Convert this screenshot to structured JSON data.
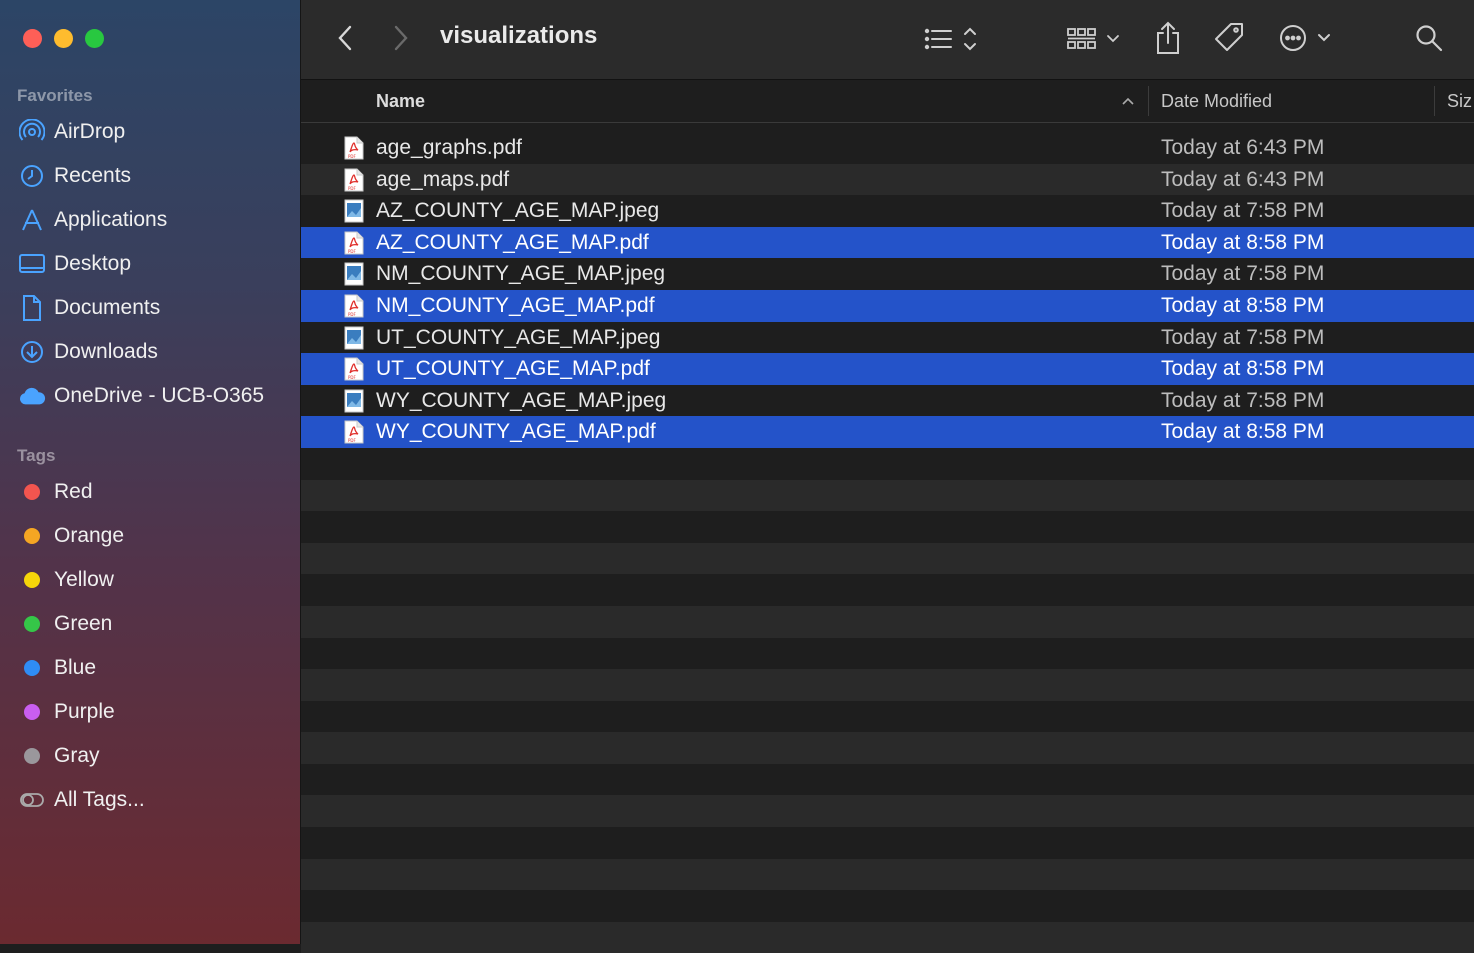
{
  "window": {
    "title": "visualizations"
  },
  "sidebar": {
    "favorites_label": "Favorites",
    "favorites": [
      {
        "label": "AirDrop",
        "icon": "airdrop-icon"
      },
      {
        "label": "Recents",
        "icon": "clock-icon"
      },
      {
        "label": "Applications",
        "icon": "applications-icon"
      },
      {
        "label": "Desktop",
        "icon": "desktop-icon"
      },
      {
        "label": "Documents",
        "icon": "document-icon"
      },
      {
        "label": "Downloads",
        "icon": "download-icon"
      },
      {
        "label": "OneDrive - UCB-O365",
        "icon": "cloud-icon"
      }
    ],
    "tags_label": "Tags",
    "tags": [
      {
        "label": "Red",
        "color": "#f2554f"
      },
      {
        "label": "Orange",
        "color": "#f5a623"
      },
      {
        "label": "Yellow",
        "color": "#f5d60a"
      },
      {
        "label": "Green",
        "color": "#35c648"
      },
      {
        "label": "Blue",
        "color": "#2f8cf5"
      },
      {
        "label": "Purple",
        "color": "#c95ef0"
      },
      {
        "label": "Gray",
        "color": "#9a979c"
      },
      {
        "label": "All Tags...",
        "color": ""
      }
    ]
  },
  "columns": {
    "name": "Name",
    "date": "Date Modified",
    "size": "Siz"
  },
  "files": [
    {
      "name": "age_graphs.pdf",
      "date": "Today at 6:43 PM",
      "type": "pdf",
      "selected": false
    },
    {
      "name": "age_maps.pdf",
      "date": "Today at 6:43 PM",
      "type": "pdf",
      "selected": false
    },
    {
      "name": "AZ_COUNTY_AGE_MAP.jpeg",
      "date": "Today at 7:58 PM",
      "type": "jpeg",
      "selected": false
    },
    {
      "name": "AZ_COUNTY_AGE_MAP.pdf",
      "date": "Today at 8:58 PM",
      "type": "pdf",
      "selected": true
    },
    {
      "name": "NM_COUNTY_AGE_MAP.jpeg",
      "date": "Today at 7:58 PM",
      "type": "jpeg",
      "selected": false
    },
    {
      "name": "NM_COUNTY_AGE_MAP.pdf",
      "date": "Today at 8:58 PM",
      "type": "pdf",
      "selected": true
    },
    {
      "name": "UT_COUNTY_AGE_MAP.jpeg",
      "date": "Today at 7:58 PM",
      "type": "jpeg",
      "selected": false
    },
    {
      "name": "UT_COUNTY_AGE_MAP.pdf",
      "date": "Today at 8:58 PM",
      "type": "pdf",
      "selected": true
    },
    {
      "name": "WY_COUNTY_AGE_MAP.jpeg",
      "date": "Today at 7:58 PM",
      "type": "jpeg",
      "selected": false
    },
    {
      "name": "WY_COUNTY_AGE_MAP.pdf",
      "date": "Today at 8:58 PM",
      "type": "pdf",
      "selected": true
    }
  ],
  "colors": {
    "selection": "#2453c9",
    "close": "#fe5f57",
    "minimize": "#febc2e",
    "zoom": "#28c840"
  }
}
